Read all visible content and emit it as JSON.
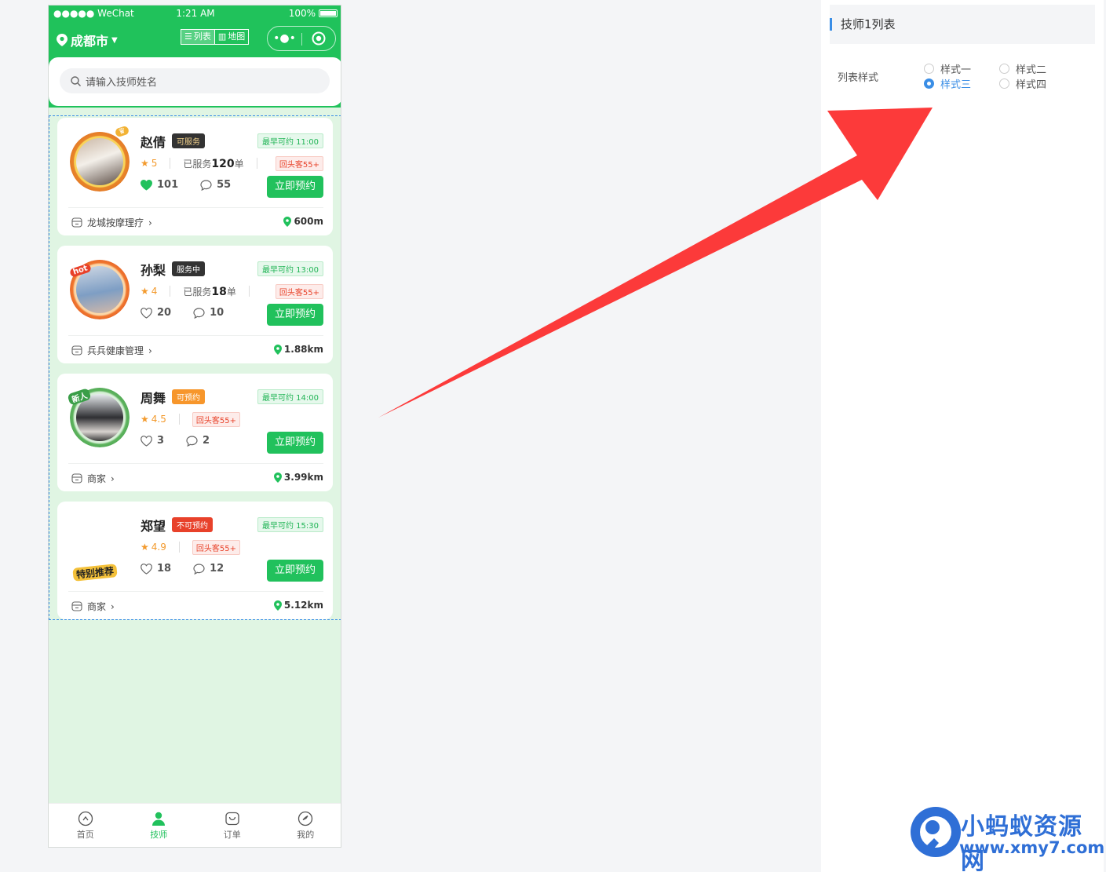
{
  "statusbar": {
    "carrier": "●●●●● WeChat",
    "time": "1:21 AM",
    "battery": "100%"
  },
  "navbar": {
    "city": "成都市",
    "tab_list": "列表",
    "tab_map": "地图"
  },
  "search": {
    "placeholder": "请输入技师姓名"
  },
  "technicians": [
    {
      "name": "赵倩",
      "status": "可服务",
      "earliest": "最早可约 11:00",
      "rating": "5",
      "served_prefix": "已服务",
      "served_count": "120",
      "served_suffix": "单",
      "returnee": "回头客55+",
      "likes": "101",
      "comments": "55",
      "book": "立即预约",
      "shop": "龙城按摩理疗",
      "distance": "600m"
    },
    {
      "name": "孙梨",
      "status": "服务中",
      "earliest": "最早可约 13:00",
      "rating": "4",
      "served_prefix": "已服务",
      "served_count": "18",
      "served_suffix": "单",
      "returnee": "回头客55+",
      "likes": "20",
      "comments": "10",
      "book": "立即预约",
      "shop": "兵兵健康管理",
      "distance": "1.88km",
      "deco": "hot"
    },
    {
      "name": "周舞",
      "status": "可预约",
      "earliest": "最早可约 14:00",
      "rating": "4.5",
      "returnee": "回头客55+",
      "likes": "3",
      "comments": "2",
      "book": "立即预约",
      "shop": "商家",
      "distance": "3.99km",
      "deco": "新人"
    },
    {
      "name": "郑望",
      "status": "不可预约",
      "earliest": "最早可约 15:30",
      "rating": "4.9",
      "returnee": "回头客55+",
      "likes": "18",
      "comments": "12",
      "book": "立即预约",
      "shop": "商家",
      "distance": "5.12km",
      "deco": "特别推荐"
    }
  ],
  "tabbar": [
    "首页",
    "技师",
    "订单",
    "我的"
  ],
  "panel": {
    "title": "技师1列表",
    "label": "列表样式",
    "options": [
      "样式一",
      "样式二",
      "样式三",
      "样式四"
    ],
    "selected": "样式三"
  },
  "watermark": {
    "line1": "小蚂蚁资源网",
    "line2": "www.xmy7.com"
  },
  "colors": {
    "primary_green": "#21c15c",
    "accent_blue": "#3a8ee6",
    "arrow_red": "#fc3a3a"
  }
}
